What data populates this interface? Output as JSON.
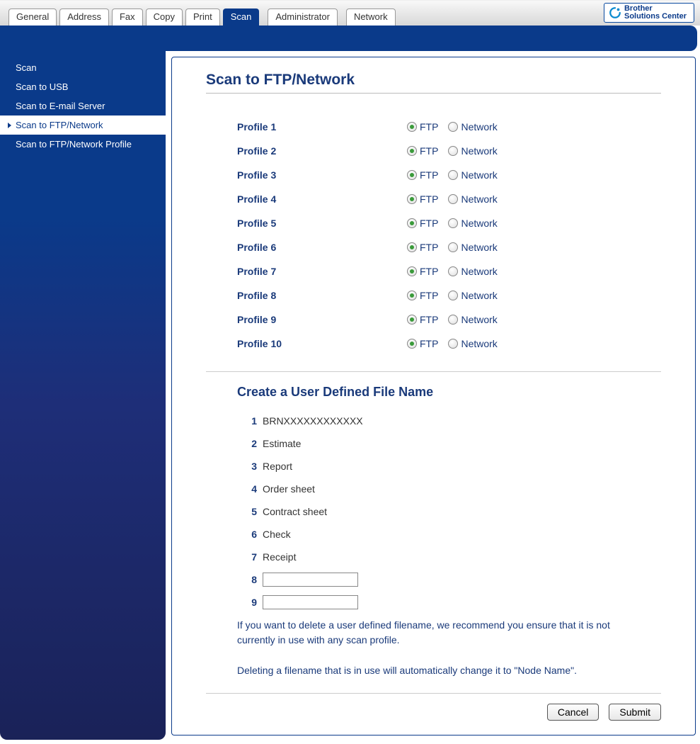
{
  "brand_link": {
    "line1": "Brother",
    "line2": "Solutions Center"
  },
  "tabs": [
    {
      "label": "General",
      "active": false,
      "spaced": false
    },
    {
      "label": "Address",
      "active": false,
      "spaced": false
    },
    {
      "label": "Fax",
      "active": false,
      "spaced": false
    },
    {
      "label": "Copy",
      "active": false,
      "spaced": false
    },
    {
      "label": "Print",
      "active": false,
      "spaced": false
    },
    {
      "label": "Scan",
      "active": true,
      "spaced": false
    },
    {
      "label": "Administrator",
      "active": false,
      "spaced": true
    },
    {
      "label": "Network",
      "active": false,
      "spaced": true
    }
  ],
  "sidebar": [
    {
      "label": "Scan",
      "active": false
    },
    {
      "label": "Scan to USB",
      "active": false
    },
    {
      "label": "Scan to E-mail Server",
      "active": false
    },
    {
      "label": "Scan to FTP/Network",
      "active": true
    },
    {
      "label": "Scan to FTP/Network Profile",
      "active": false
    }
  ],
  "page_title": "Scan to FTP/Network",
  "radio_labels": {
    "ftp": "FTP",
    "network": "Network"
  },
  "profiles": [
    {
      "label": "Profile 1",
      "selected": "FTP"
    },
    {
      "label": "Profile 2",
      "selected": "FTP"
    },
    {
      "label": "Profile 3",
      "selected": "FTP"
    },
    {
      "label": "Profile 4",
      "selected": "FTP"
    },
    {
      "label": "Profile 5",
      "selected": "FTP"
    },
    {
      "label": "Profile 6",
      "selected": "FTP"
    },
    {
      "label": "Profile 7",
      "selected": "FTP"
    },
    {
      "label": "Profile 8",
      "selected": "FTP"
    },
    {
      "label": "Profile 9",
      "selected": "FTP"
    },
    {
      "label": "Profile 10",
      "selected": "FTP"
    }
  ],
  "filenames_title": "Create a User Defined File Name",
  "filenames": [
    {
      "num": "1",
      "value": "BRNXXXXXXXXXXXX",
      "editable": false
    },
    {
      "num": "2",
      "value": "Estimate",
      "editable": false
    },
    {
      "num": "3",
      "value": "Report",
      "editable": false
    },
    {
      "num": "4",
      "value": "Order sheet",
      "editable": false
    },
    {
      "num": "5",
      "value": "Contract sheet",
      "editable": false
    },
    {
      "num": "6",
      "value": "Check",
      "editable": false
    },
    {
      "num": "7",
      "value": "Receipt",
      "editable": false
    },
    {
      "num": "8",
      "value": "",
      "editable": true
    },
    {
      "num": "9",
      "value": "",
      "editable": true
    }
  ],
  "note1": "If you want to delete a user defined filename, we recommend you ensure that it is not currently in use with any scan profile.",
  "note2": "Deleting a filename that is in use will automatically change it to \"Node Name\".",
  "buttons": {
    "cancel": "Cancel",
    "submit": "Submit"
  }
}
